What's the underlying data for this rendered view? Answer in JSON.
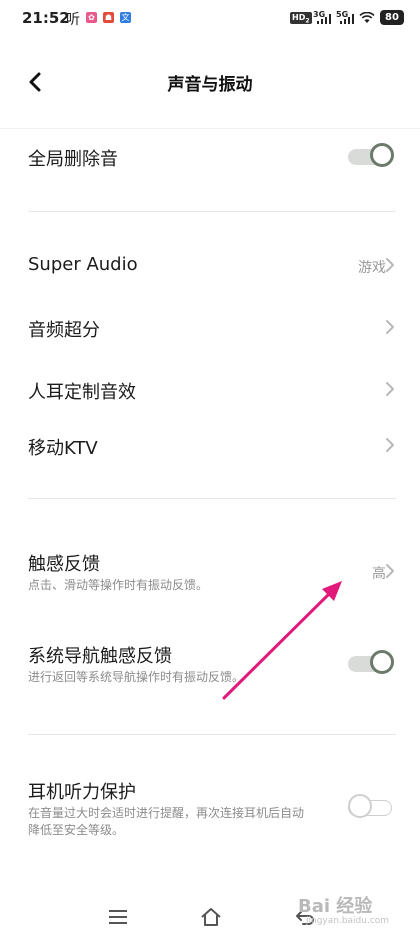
{
  "status_bar": {
    "time": "21:52",
    "ting_glyph": "听",
    "apps": [
      {
        "name": "app-icon-1",
        "glyph": "✿",
        "color": "#e85a8c"
      },
      {
        "name": "app-icon-2",
        "glyph": "☗",
        "color": "#e24a3b"
      },
      {
        "name": "app-icon-3",
        "glyph": "文",
        "color": "#2f7de1"
      }
    ],
    "hd_label": "HD",
    "hd_sub": "2",
    "network_1": "3G",
    "network_2": "5G",
    "battery": "80"
  },
  "header": {
    "title": "声音与振动",
    "back_icon": "chevron-left-icon"
  },
  "rows": {
    "global_delete_sound": {
      "label": "全局删除音",
      "toggle": "on"
    },
    "super_audio": {
      "label": "Super Audio",
      "value": "游戏"
    },
    "audio_super_resolution": {
      "label": "音频超分"
    },
    "custom_ear_sound": {
      "label": "人耳定制音效"
    },
    "mobile_ktv": {
      "label": "移动KTV"
    },
    "haptic_feedback": {
      "label": "触感反馈",
      "desc": "点击、滑动等操作时有振动反馈。",
      "value": "高"
    },
    "system_nav_haptic": {
      "label": "系统导航触感反馈",
      "desc": "进行返回等系统导航操作时有振动反馈。",
      "toggle": "on"
    },
    "headphone_protection": {
      "label": "耳机听力保护",
      "desc": "在音量过大时会适时进行提醒，再次连接耳机后自动降低至安全等级。",
      "toggle": "off"
    }
  },
  "nav_bar": {
    "menu_icon": "menu-icon",
    "home_icon": "home-icon",
    "back_icon": "back-icon"
  },
  "watermark": {
    "text": "Bai 经验",
    "sub": "jingyan.baidu.com"
  },
  "annotation": {
    "arrow_color": "#e0197a"
  }
}
